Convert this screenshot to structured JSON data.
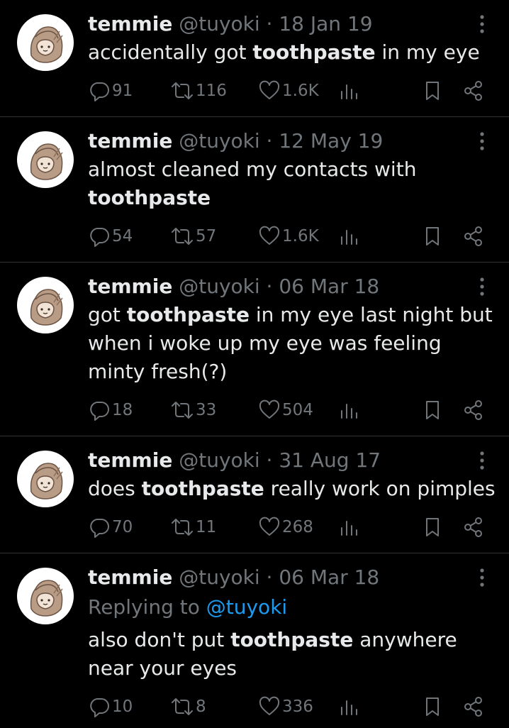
{
  "tweets": [
    {
      "name": "temmie",
      "handle": "@tuyoki",
      "date": "18 Jan 19",
      "text_parts": [
        "accidentally got ",
        "toothpaste",
        " in my eye"
      ],
      "replying_to": null,
      "replies": "91",
      "retweets": "116",
      "likes": "1.6K"
    },
    {
      "name": "temmie",
      "handle": "@tuyoki",
      "date": "12 May 19",
      "text_parts": [
        "almost cleaned my contacts with ",
        "toothpaste",
        ""
      ],
      "replying_to": null,
      "replies": "54",
      "retweets": "57",
      "likes": "1.6K"
    },
    {
      "name": "temmie",
      "handle": "@tuyoki",
      "date": "06 Mar 18",
      "text_parts": [
        "got ",
        "toothpaste",
        " in my eye last night but when i woke up my eye was feeling minty fresh(?)"
      ],
      "replying_to": null,
      "replies": "18",
      "retweets": "33",
      "likes": "504"
    },
    {
      "name": "temmie",
      "handle": "@tuyoki",
      "date": "31 Aug 17",
      "text_parts": [
        "does ",
        "toothpaste",
        " really work on pimples"
      ],
      "replying_to": null,
      "replies": "70",
      "retweets": "11",
      "likes": "268"
    },
    {
      "name": "temmie",
      "handle": "@tuyoki",
      "date": "06 Mar 18",
      "text_parts": [
        "also don't put ",
        "toothpaste",
        " anywhere near your eyes"
      ],
      "replying_to": {
        "prefix": "Replying to ",
        "mention": "@tuyoki"
      },
      "replies": "10",
      "retweets": "8",
      "likes": "336"
    }
  ],
  "separator": " · ",
  "icons": {
    "more": "more-dots-icon",
    "reply": "reply-icon",
    "retweet": "retweet-icon",
    "like": "heart-icon",
    "views": "views-chart-icon",
    "bookmark": "bookmark-icon",
    "share": "share-icon"
  },
  "colors": {
    "background": "#000000",
    "text": "#e7e9ea",
    "muted": "#71767b",
    "mention": "#1d9bf0",
    "divider": "#2f3336"
  }
}
